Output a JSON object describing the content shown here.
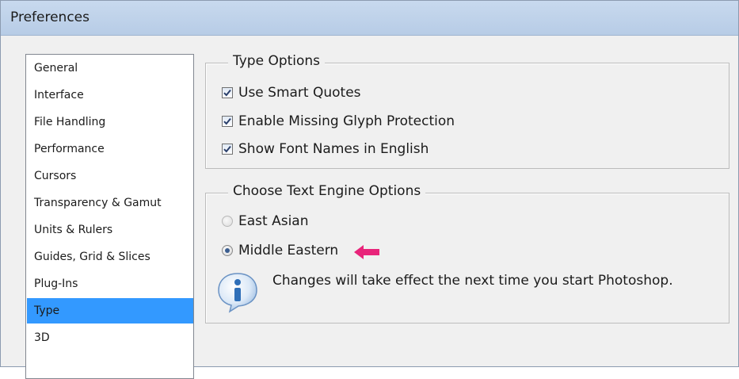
{
  "window": {
    "title": "Preferences"
  },
  "sidebar": {
    "selected_index": 9,
    "items": [
      {
        "label": "General"
      },
      {
        "label": "Interface"
      },
      {
        "label": "File Handling"
      },
      {
        "label": "Performance"
      },
      {
        "label": "Cursors"
      },
      {
        "label": "Transparency & Gamut"
      },
      {
        "label": "Units & Rulers"
      },
      {
        "label": "Guides, Grid & Slices"
      },
      {
        "label": "Plug-Ins"
      },
      {
        "label": "Type"
      },
      {
        "label": "3D"
      }
    ]
  },
  "type_options": {
    "legend": "Type Options",
    "use_smart_quotes": {
      "label": "Use Smart Quotes",
      "checked": true
    },
    "enable_missing_glyph": {
      "label": "Enable Missing Glyph Protection",
      "checked": true
    },
    "show_font_names_english": {
      "label": "Show Font Names in English",
      "checked": true
    }
  },
  "text_engine": {
    "legend": "Choose Text Engine Options",
    "east_asian": {
      "label": "East Asian",
      "selected": false
    },
    "middle_eastern": {
      "label": "Middle Eastern",
      "selected": true
    },
    "info_message": "Changes will take effect the next time you start Photoshop."
  },
  "icons": {
    "info": "info-icon",
    "arrow": "arrow-left-icon",
    "checkmark": "checkmark-icon"
  },
  "colors": {
    "selection": "#3399ff",
    "titlebar": "#bfd3ec",
    "arrow": "#e8247a",
    "info_icon": "#2f6fb8"
  }
}
